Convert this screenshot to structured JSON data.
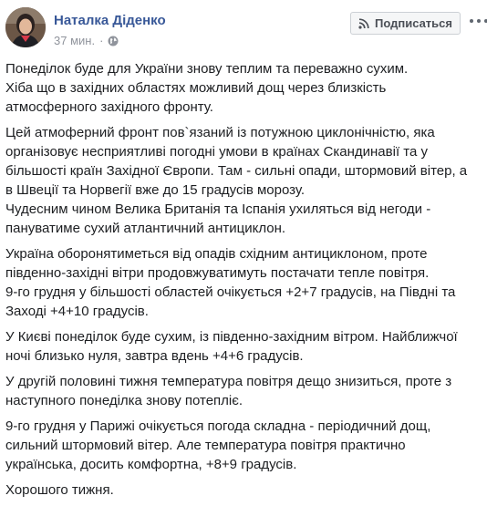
{
  "post": {
    "author": "Наталка Діденко",
    "time": "37 мин.",
    "separator": "·",
    "privacy_icon": "globe-icon",
    "subscribe_label": "Подписаться",
    "subscribe_icon": "rss-icon",
    "more_icon": "more-options-icon",
    "paragraphs": [
      "Понеділок буде для України знову теплим та переважно сухим.\nХіба що в західних областях можливий дощ через близкість\nатмосферного західного фронту.",
      "Цей атмоферний фронт пов`язаний із потужною циклонічністю, яка\nорганізовує несприятливі погодні умови в країнах Скандинавії та у\nбільшості країн Західної Європи. Там - сильні опади, штормовий вітер, а\nв Швеції та Норвегії вже до 15 градусів морозу.\nЧудесним чином Велика Британія та Іспанія ухиляться від негоди -\nпануватиме сухий атлантичний антициклон.",
      "Україна оборонятиметься від опадів східним антициклоном, проте\nпівденно-західні вітри продовжуватимуть постачати тепле повітря.\n9-го грудня у більшості областей очікується +2+7 градусів, на Півдні та\nЗаході +4+10 градусів.",
      "У Києві понеділок буде сухим, із південно-західним вітром. Найближчої\nночі близько нуля, завтра вдень +4+6 градусів.",
      "У другій половині тижня температура повітря дещо знизиться, проте з\nнаступного понеділка знову потепліє.",
      "9-го грудня у Парижі очікується погода складна - періодичний дощ,\nсильний штормовий вітер. Але температура повітря практично\nукраїнська, досить комфортна, +8+9 градусів.",
      "Хорошого тижня."
    ]
  },
  "colors": {
    "author_link": "#385898",
    "meta_text": "#90949c",
    "body_text": "#1c1e21",
    "button_bg": "#f5f6f7",
    "button_border": "#ccd0d5"
  }
}
